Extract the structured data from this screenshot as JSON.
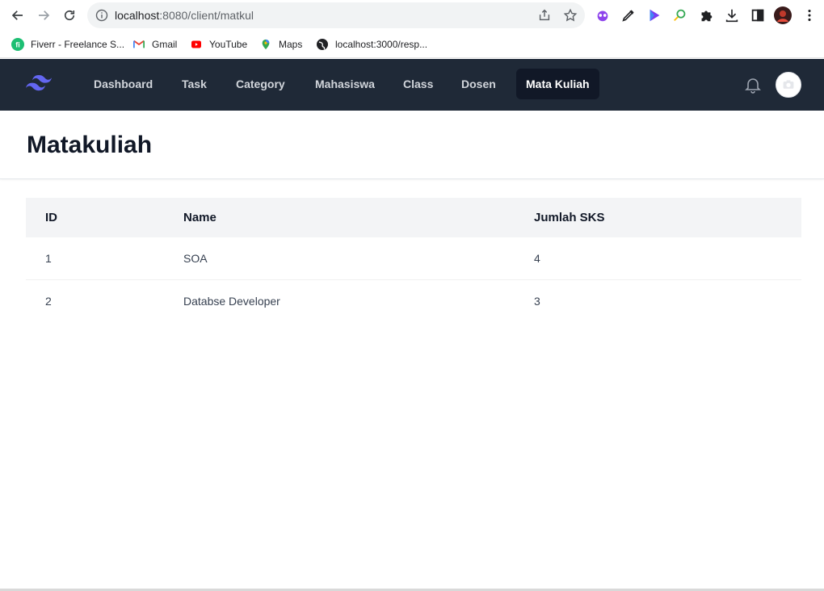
{
  "browser": {
    "url_host": "localhost",
    "url_rest": ":8080/client/matkul",
    "bookmarks": [
      {
        "label": "Fiverr - Freelance S...",
        "icon": "fiverr-icon"
      },
      {
        "label": "Gmail",
        "icon": "gmail-icon"
      },
      {
        "label": "YouTube",
        "icon": "youtube-icon"
      },
      {
        "label": "Maps",
        "icon": "maps-icon"
      },
      {
        "label": "localhost:3000/resp...",
        "icon": "globe-icon"
      }
    ]
  },
  "nav": {
    "items": [
      {
        "label": "Dashboard"
      },
      {
        "label": "Task"
      },
      {
        "label": "Category"
      },
      {
        "label": "Mahasiswa"
      },
      {
        "label": "Class"
      },
      {
        "label": "Dosen"
      },
      {
        "label": "Mata Kuliah",
        "active": true
      }
    ]
  },
  "page": {
    "title": "Matakuliah"
  },
  "table": {
    "columns": [
      "ID",
      "Name",
      "Jumlah SKS"
    ],
    "rows": [
      [
        "1",
        "SOA",
        "4"
      ],
      [
        "2",
        "Databse Developer",
        "3"
      ]
    ]
  },
  "colors": {
    "nav_bg": "#1f2937",
    "nav_active_bg": "#111827",
    "accent": "#6366f1"
  }
}
